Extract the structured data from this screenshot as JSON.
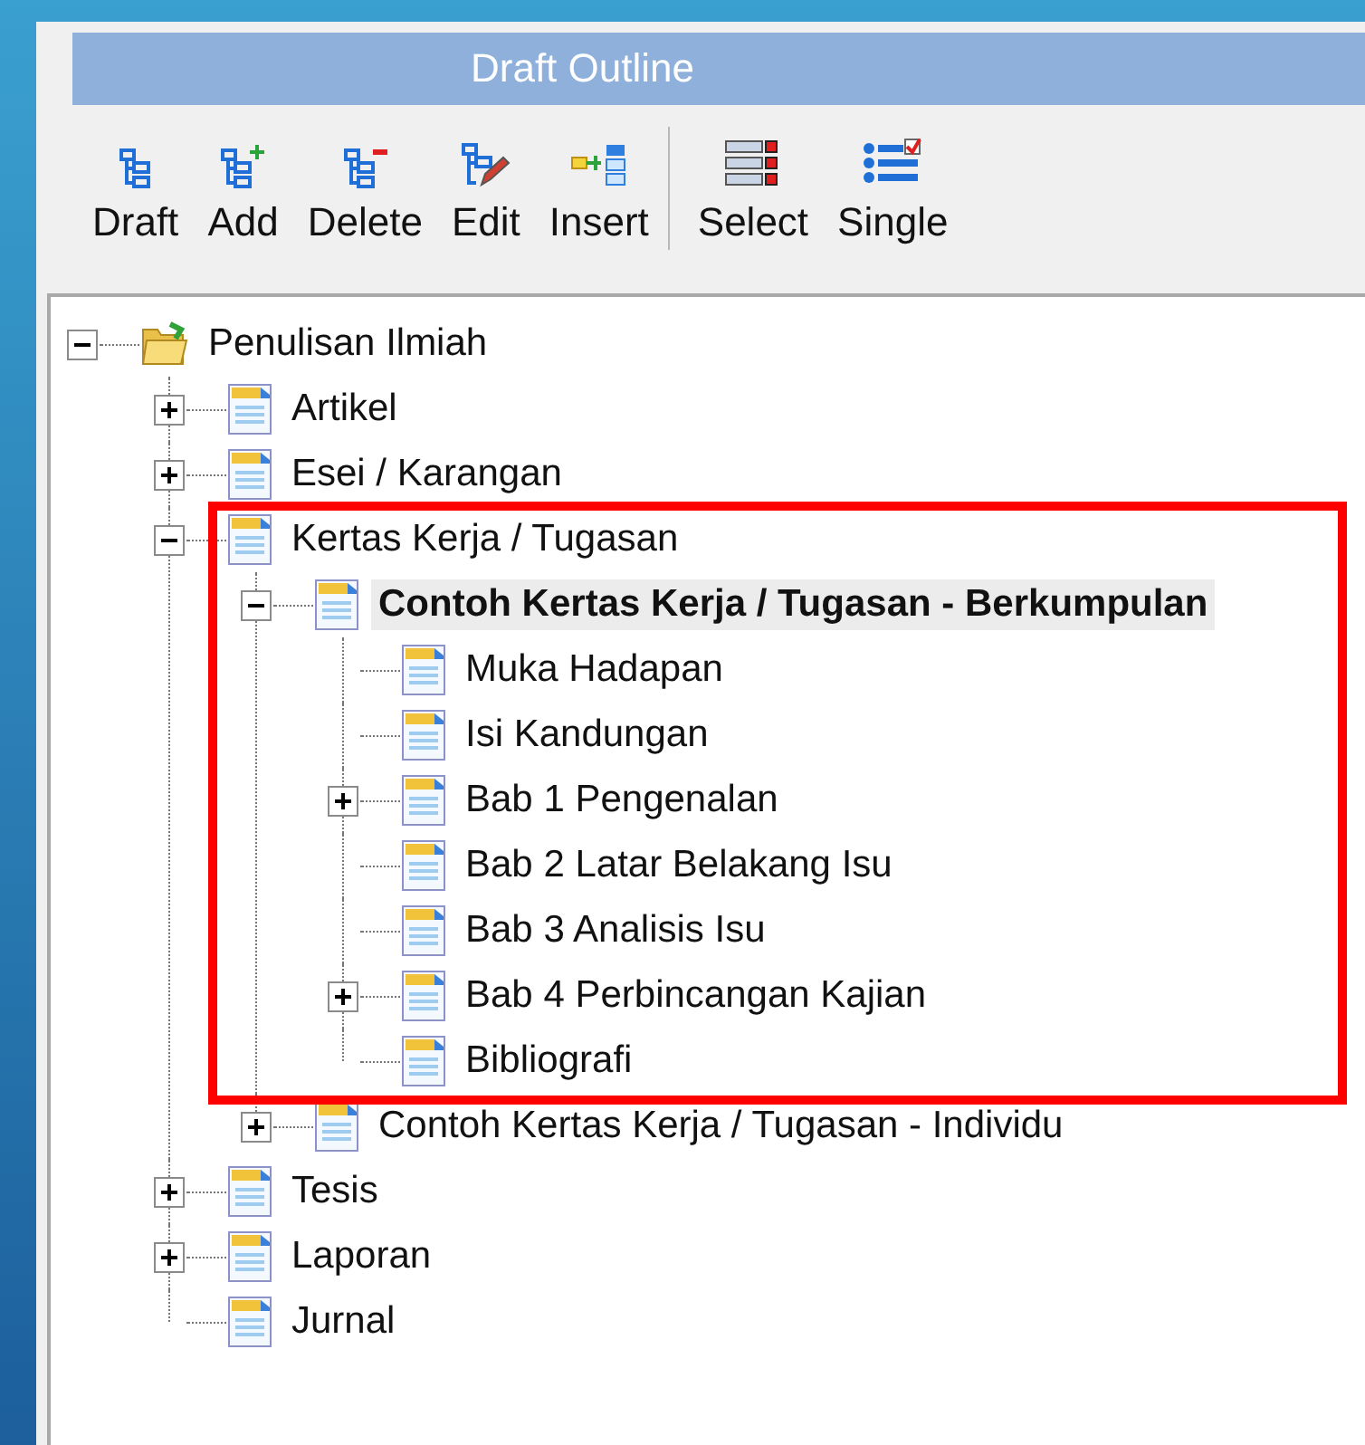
{
  "window": {
    "title": "Draft Outline"
  },
  "toolbar": [
    {
      "label": "Draft",
      "kind": "tree"
    },
    {
      "label": "Add",
      "kind": "add"
    },
    {
      "label": "Delete",
      "kind": "delete"
    },
    {
      "label": "Edit",
      "kind": "edit"
    },
    {
      "label": "Insert",
      "kind": "insert"
    },
    {
      "label": "Select",
      "kind": "select",
      "separator_before": true
    },
    {
      "label": "Single",
      "kind": "single"
    }
  ],
  "tree": [
    {
      "label": "Penulisan Ilmiah",
      "kind": "folder",
      "expanded": true,
      "selected": false,
      "children": [
        {
          "label": "Artikel",
          "kind": "document",
          "expanded": false,
          "selected": false
        },
        {
          "label": "Esei / Karangan",
          "kind": "document",
          "expanded": false,
          "selected": false
        },
        {
          "label": "Kertas Kerja / Tugasan",
          "kind": "document",
          "expanded": true,
          "selected": false,
          "children": [
            {
              "label": "Contoh Kertas Kerja / Tugasan - Berkumpulan",
              "kind": "document",
              "expanded": true,
              "selected": true,
              "children": [
                {
                  "label": "Muka Hadapan",
                  "kind": "document",
                  "selected": false
                },
                {
                  "label": "Isi Kandungan",
                  "kind": "document",
                  "selected": false
                },
                {
                  "label": "Bab 1 Pengenalan",
                  "kind": "document",
                  "expanded": false,
                  "selected": false
                },
                {
                  "label": "Bab 2 Latar Belakang Isu",
                  "kind": "document",
                  "selected": false
                },
                {
                  "label": "Bab 3 Analisis Isu",
                  "kind": "document",
                  "selected": false
                },
                {
                  "label": "Bab 4 Perbincangan Kajian",
                  "kind": "document",
                  "expanded": false,
                  "selected": false
                },
                {
                  "label": "Bibliografi",
                  "kind": "document",
                  "selected": false
                }
              ]
            },
            {
              "label": "Contoh Kertas Kerja / Tugasan - Individu",
              "kind": "document",
              "expanded": false,
              "selected": false
            }
          ]
        },
        {
          "label": "Tesis",
          "kind": "document",
          "expanded": false,
          "selected": false
        },
        {
          "label": "Laporan",
          "kind": "document",
          "expanded": false,
          "selected": false
        },
        {
          "label": "Jurnal",
          "kind": "document",
          "selected": false
        }
      ]
    }
  ],
  "highlight_frame": {
    "shown": true
  }
}
